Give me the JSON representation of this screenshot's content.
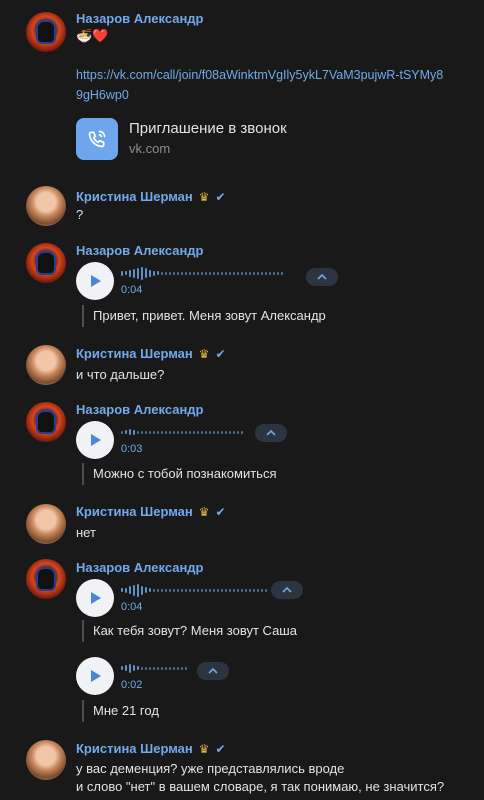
{
  "messages": {
    "m1": {
      "author": "Назаров Александр",
      "emoji": "🍜❤️",
      "link": "https://vk.com/call/join/f08aWinktmVgIly5ykL7VaM3pujwR-tSYMy89gH6wp0",
      "card_title": "Приглашение в звонок",
      "card_domain": "vk.com"
    },
    "m2": {
      "author": "Кристина Шерман",
      "text": "?"
    },
    "m3": {
      "author": "Назаров Александр",
      "duration": "0:04",
      "transcript": "Привет, привет. Меня зовут Александр"
    },
    "m4": {
      "author": "Кристина Шерман",
      "text": "и что дальше?"
    },
    "m5": {
      "author": "Назаров Александр",
      "duration": "0:03",
      "transcript": "Можно с тобой познакомиться"
    },
    "m6": {
      "author": "Кристина Шерман",
      "text": "нет"
    },
    "m7": {
      "author": "Назаров Александр",
      "duration": "0:04",
      "transcript": "Как тебя зовут? Меня зовут Саша",
      "duration2": "0:02",
      "transcript2": "Мне 21 год"
    },
    "m8": {
      "author": "Кристина Шерман",
      "line1": "у вас деменция? уже представлялись вроде",
      "line2": "и слово \"нет\" в вашем словаре, я так понимаю, не значится?"
    }
  },
  "icons": {
    "crown": "crown-icon",
    "verified": "verified-check-icon",
    "play": "play-icon",
    "transcript_toggle": "chevron-up-icon",
    "call": "phone-call-icon"
  },
  "colors": {
    "background": "#19191a",
    "accent": "#71aaeb",
    "text": "#e1e3e6",
    "crown": "#e2b640"
  }
}
